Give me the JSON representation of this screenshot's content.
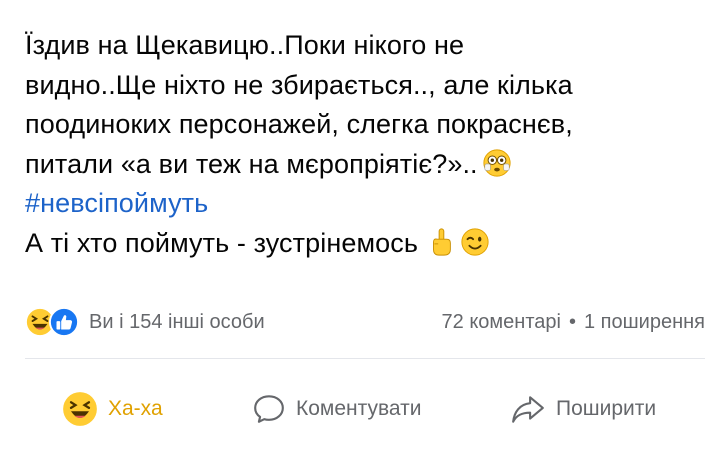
{
  "post": {
    "lines": [
      "Їздив на Щекавицю..Поки нікого не",
      "видно..Ще ніхто не збирається.., але кілька",
      "поодиноких персонажей, слегка покраснєв,",
      "питали «а ви теж на мєропріятіє?».."
    ],
    "hashtag": "#невсіпоймуть",
    "last_line": "А ті хто поймуть - зустрінемось",
    "emojis": [
      "flushed-face",
      "hand-pointing-up",
      "winking-face"
    ]
  },
  "stats": {
    "reactions": [
      "haha",
      "like"
    ],
    "reactors_text": "Ви і 154 інші особи",
    "comments_text": "72 коментарі",
    "separator": "•",
    "shares_text": "1 поширення"
  },
  "actions": {
    "haha_label": "Ха-ха",
    "comment_label": "Коментувати",
    "share_label": "Поширити"
  },
  "colors": {
    "hashtag": "#1d63c9",
    "meta_text": "#65676b",
    "haha_accent": "#e0a100",
    "like_blue": "#1877f2",
    "emoji_yellow": "#ffcc33"
  }
}
